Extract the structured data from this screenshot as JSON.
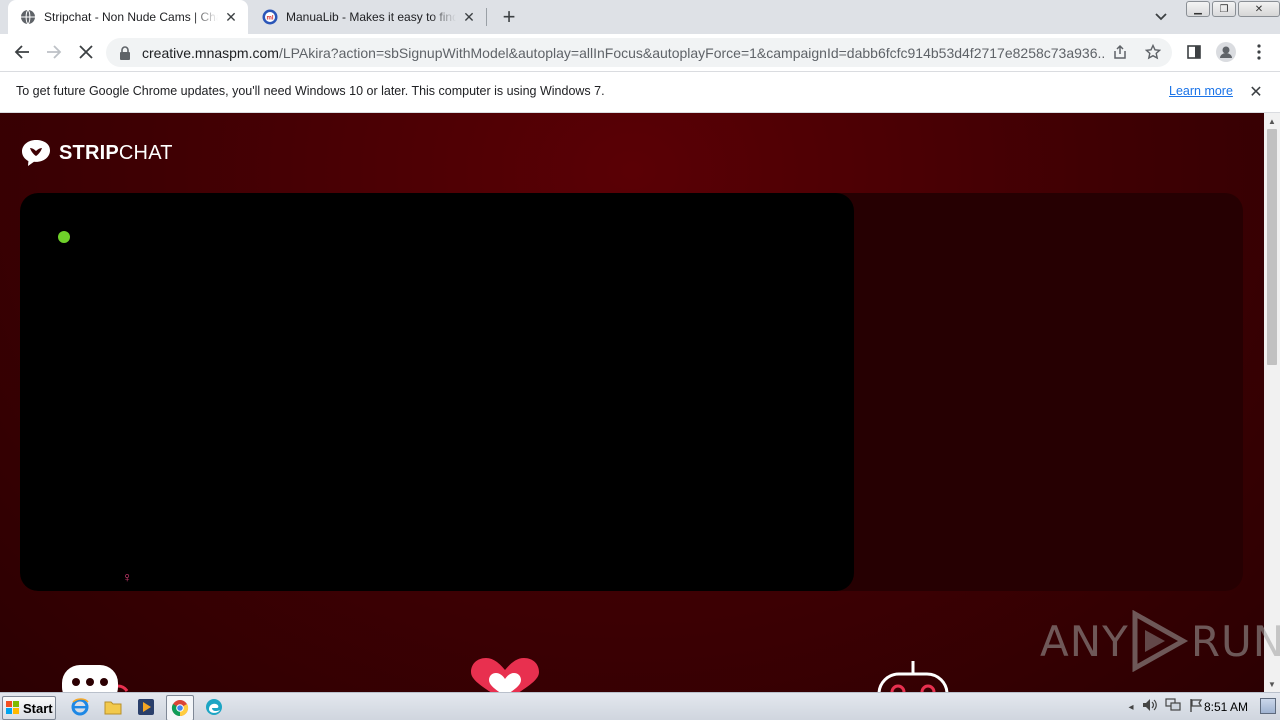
{
  "browser": {
    "tabs": [
      {
        "title": "Stripchat - Non Nude Cams | Chat with",
        "favicon": "globe-icon",
        "active": true
      },
      {
        "title": "ManuaLib - Makes it easy to find manuals",
        "favicon": "manualib-icon",
        "active": false
      }
    ],
    "new_tab_symbol": "+",
    "url_host": "creative.mnaspm.com",
    "url_path": "/LPAkira?action=sbSignupWithModel&autoplay=allInFocus&autoplayForce=1&campaignId=dabb6fcfc914b53d4f2717e8258c73a936..."
  },
  "infobar": {
    "message": "To get future Google Chrome updates, you'll need Windows 10 or later. This computer is using Windows 7.",
    "link": "Learn more"
  },
  "page": {
    "logo_bold": "STRIP",
    "logo_regular": "CHAT",
    "gender_symbol": "♀",
    "live_color": "#6fd12a",
    "accent_color": "#e8304f"
  },
  "watermark": {
    "left": "ANY",
    "right": "RUN"
  },
  "taskbar": {
    "start_label": "Start",
    "pinned": [
      "ie-icon",
      "explorer-icon",
      "media-player-icon",
      "chrome-icon",
      "edge-icon"
    ],
    "clock": "8:51 AM"
  }
}
